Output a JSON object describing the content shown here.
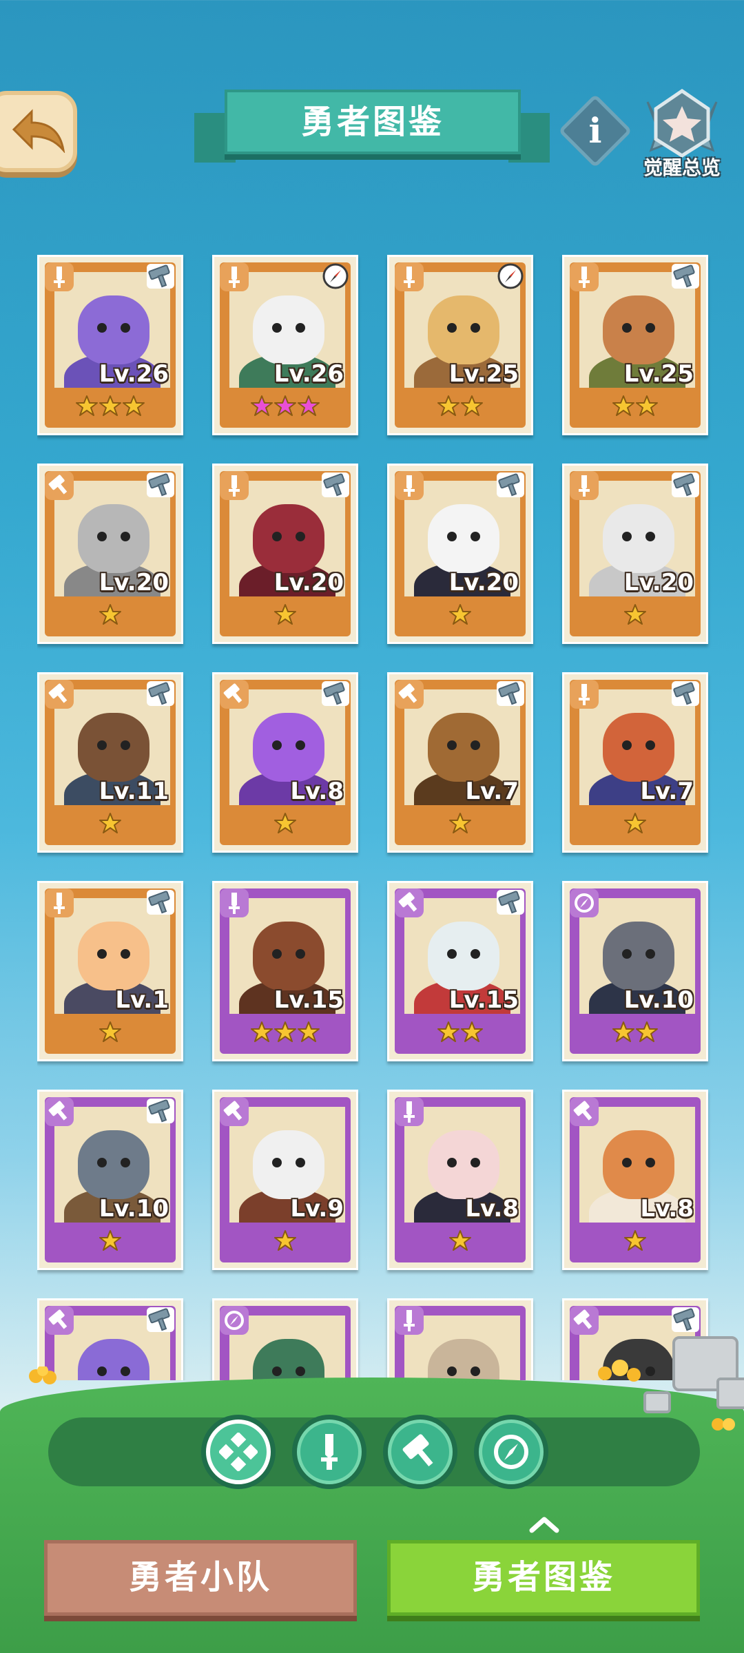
{
  "header": {
    "title": "勇者图鉴",
    "info_label": "i",
    "awaken_label": "觉醒总览"
  },
  "cards": [
    {
      "lv": "Lv.26",
      "stars": 3,
      "star_color": "#f7c531",
      "frame": "orange",
      "class": "sword",
      "weapon": "hammer",
      "palette": [
        "#8c6bd6",
        "#6b52b8"
      ]
    },
    {
      "lv": "Lv.26",
      "stars": 3,
      "star_color": "#e94fd6",
      "frame": "orange",
      "class": "sword",
      "weapon": "compass",
      "palette": [
        "#f1f1f1",
        "#3e7b5a"
      ]
    },
    {
      "lv": "Lv.25",
      "stars": 2,
      "star_color": "#f7c531",
      "frame": "orange",
      "class": "sword",
      "weapon": "compass",
      "palette": [
        "#e5b86c",
        "#9b6a3a"
      ]
    },
    {
      "lv": "Lv.25",
      "stars": 2,
      "star_color": "#f7c531",
      "frame": "orange",
      "class": "sword",
      "weapon": "hammer",
      "palette": [
        "#c9814a",
        "#6f7c3a"
      ]
    },
    {
      "lv": "Lv.20",
      "stars": 1,
      "star_color": "#f7c531",
      "frame": "orange",
      "class": "hammer",
      "weapon": "hammer",
      "palette": [
        "#b7b7b7",
        "#888888"
      ]
    },
    {
      "lv": "Lv.20",
      "stars": 1,
      "star_color": "#f7c531",
      "frame": "orange",
      "class": "sword",
      "weapon": "hammer",
      "palette": [
        "#9a2d3a",
        "#6b1e29"
      ]
    },
    {
      "lv": "Lv.20",
      "stars": 1,
      "star_color": "#f7c531",
      "frame": "orange",
      "class": "sword",
      "weapon": "hammer",
      "palette": [
        "#f4f4f4",
        "#2a2a3a"
      ]
    },
    {
      "lv": "Lv.20",
      "stars": 1,
      "star_color": "#f7c531",
      "frame": "orange",
      "class": "sword",
      "weapon": "hammer",
      "palette": [
        "#e9e9e9",
        "#c8c8c8"
      ]
    },
    {
      "lv": "Lv.11",
      "stars": 1,
      "star_color": "#f7c531",
      "frame": "orange",
      "class": "hammer",
      "weapon": "hammer",
      "palette": [
        "#7a5236",
        "#3c4c62"
      ]
    },
    {
      "lv": "Lv.8",
      "stars": 1,
      "star_color": "#f7c531",
      "frame": "orange",
      "class": "hammer",
      "weapon": "hammer",
      "palette": [
        "#a15fe0",
        "#6c3aa6"
      ]
    },
    {
      "lv": "Lv.7",
      "stars": 1,
      "star_color": "#f7c531",
      "frame": "orange",
      "class": "hammer",
      "weapon": "hammer",
      "palette": [
        "#a06a34",
        "#5b3b1e"
      ]
    },
    {
      "lv": "Lv.7",
      "stars": 1,
      "star_color": "#f7c531",
      "frame": "orange",
      "class": "sword",
      "weapon": "hammer",
      "palette": [
        "#d2643a",
        "#3d3f86"
      ]
    },
    {
      "lv": "Lv.1",
      "stars": 1,
      "star_color": "#f7c531",
      "frame": "orange",
      "class": "sword",
      "weapon": "hammer",
      "palette": [
        "#f7c08a",
        "#4a4a62"
      ]
    },
    {
      "lv": "Lv.15",
      "stars": 3,
      "star_color": "#f7c531",
      "frame": "purple",
      "class": "sword",
      "weapon": "",
      "palette": [
        "#8b4b2e",
        "#5e3320"
      ]
    },
    {
      "lv": "Lv.15",
      "stars": 2,
      "star_color": "#f7c531",
      "frame": "purple",
      "class": "hammer",
      "weapon": "hammer",
      "palette": [
        "#e6eef0",
        "#c23a3a"
      ]
    },
    {
      "lv": "Lv.10",
      "stars": 2,
      "star_color": "#f7c531",
      "frame": "purple",
      "class": "compass",
      "weapon": "",
      "palette": [
        "#6b6f7a",
        "#2d3448"
      ]
    },
    {
      "lv": "Lv.10",
      "stars": 1,
      "star_color": "#f7c531",
      "frame": "purple",
      "class": "hammer",
      "weapon": "hammer",
      "palette": [
        "#6e7b8a",
        "#7a5a3a"
      ]
    },
    {
      "lv": "Lv.9",
      "stars": 1,
      "star_color": "#f7c531",
      "frame": "purple",
      "class": "hammer",
      "weapon": "",
      "palette": [
        "#f0f0f0",
        "#7b3f2b"
      ]
    },
    {
      "lv": "Lv.8",
      "stars": 1,
      "star_color": "#f7c531",
      "frame": "purple",
      "class": "sword",
      "weapon": "",
      "palette": [
        "#f4d6d6",
        "#2a2a3a"
      ]
    },
    {
      "lv": "Lv.8",
      "stars": 1,
      "star_color": "#f7c531",
      "frame": "purple",
      "class": "hammer",
      "weapon": "",
      "palette": [
        "#e08a4a",
        "#f2e8d8"
      ]
    },
    {
      "lv": "",
      "stars": 0,
      "star_color": "#f7c531",
      "frame": "purple",
      "class": "hammer",
      "weapon": "hammer",
      "palette": [
        "#8a6bd6",
        "#5b4a9a"
      ]
    },
    {
      "lv": "",
      "stars": 0,
      "star_color": "#f7c531",
      "frame": "purple",
      "class": "compass",
      "weapon": "",
      "palette": [
        "#3e7b5a",
        "#2a4a3a"
      ]
    },
    {
      "lv": "",
      "stars": 0,
      "star_color": "#f7c531",
      "frame": "purple",
      "class": "sword",
      "weapon": "",
      "palette": [
        "#c9b59a",
        "#7a6a52"
      ]
    },
    {
      "lv": "",
      "stars": 0,
      "star_color": "#f7c531",
      "frame": "purple",
      "class": "hammer",
      "weapon": "hammer",
      "palette": [
        "#3a3a3a",
        "#5a5a5a"
      ]
    }
  ],
  "filters": [
    {
      "icon": "all-icon",
      "active": true
    },
    {
      "icon": "sword-icon",
      "active": false
    },
    {
      "icon": "hammer-icon",
      "active": false
    },
    {
      "icon": "compass-icon",
      "active": false
    }
  ],
  "tabs": {
    "team_label": "勇者小队",
    "codex_label": "勇者图鉴"
  }
}
